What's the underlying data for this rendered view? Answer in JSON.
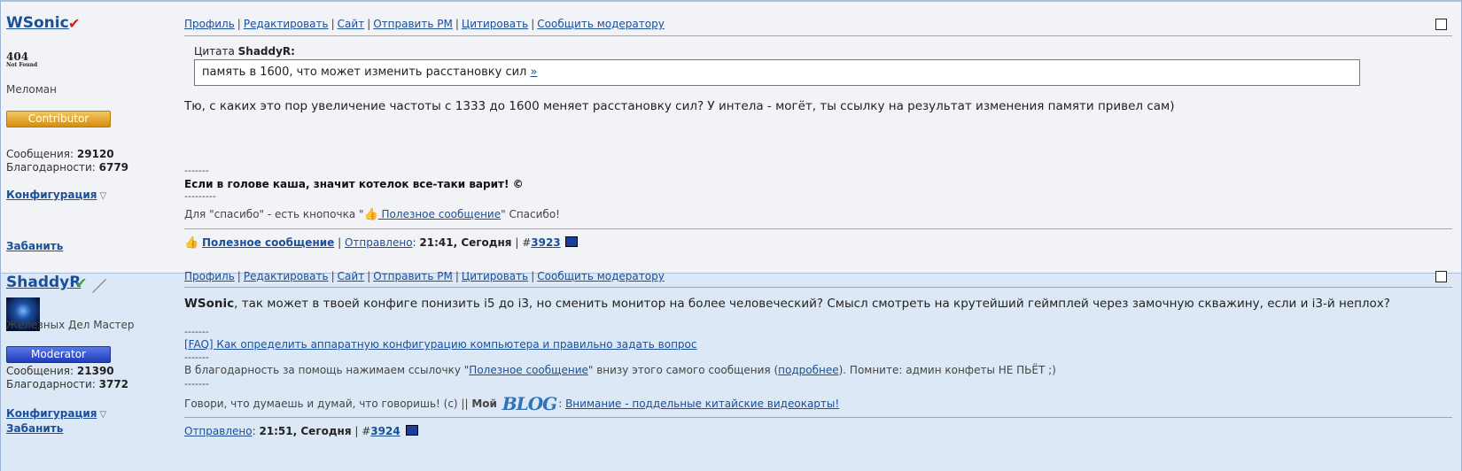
{
  "posts": [
    {
      "username": "WSonic",
      "title_icon": "check-red-icon",
      "avatar_text_big": "404",
      "avatar_text_small": "Not Found",
      "user_title": "Меломан",
      "badge": "Contributor",
      "messages_label": "Сообщения:",
      "messages_count": "29120",
      "thanks_label": "Благодарности:",
      "thanks_count": "6779",
      "config_link": "Конфигурация",
      "ban_link": "Забанить",
      "actions": [
        "Профиль",
        "Редактировать",
        "Сайт",
        "Отправить PM",
        "Цитировать",
        "Сообщить модератору"
      ],
      "quote": {
        "label": "Цитата",
        "author": "ShaddyR:",
        "text": "память в 1600, что может изменить расстановку сил",
        "link": "»"
      },
      "body": "Тю, с каких это пор увеличение частоты с 1333 до 1600 меняет расстановку сил? У интела - могёт, ты ссылку на результат изменения памяти привел сам)",
      "signature": {
        "sep1": "-------",
        "bold_line": "Если в голове каша, значит котелок все-таки варит! ©",
        "sep2": "---------",
        "line_pre": "Для \"спасибо\" - есть кнопочка \"",
        "line_link": " Полезное сообщение",
        "line_post": "\" Спасибо!"
      },
      "footer": {
        "useful": "Полезное сообщение",
        "sent_label": "Отправлено",
        "sent_time": "21:41, Сегодня",
        "hash": "#",
        "post_num": "3923"
      }
    },
    {
      "username": "ShaddyR",
      "title_icon": "check-green-icon",
      "user_title": "Железных Дел Мастер",
      "badge": "Moderator",
      "messages_label": "Сообщения:",
      "messages_count": "21390",
      "thanks_label": "Благодарности:",
      "thanks_count": "3772",
      "config_link": "Конфигурация",
      "ban_link": "Забанить",
      "actions": [
        "Профиль",
        "Редактировать",
        "Сайт",
        "Отправить PM",
        "Цитировать",
        "Сообщить модератору"
      ],
      "body_bold": "WSonic",
      "body": ", так может в твоей конфиге понизить i5 до i3, но сменить монитор на более человеческий? Смысл смотреть на крутейший геймплей через замочную скважину, если и i3-й неплох?",
      "signature": {
        "sep1": "-------",
        "faq_link": "[FAQ] Как определить аппаратную конфигурацию компьютера и правильно задать вопрос",
        "sep2": "-------",
        "thanks_pre": "В благодарность за помощь нажимаем ссылочку \"",
        "thanks_link": "Полезное сообщение",
        "thanks_mid": "\" внизу этого самого сообщения (",
        "thanks_link2": "подробнее",
        "thanks_post": "). Помните: админ конфеты НЕ ПЬЁТ ;)",
        "sep3": "-------",
        "motto": "Говори, что думаешь и думай, что говоришь! (с) || ",
        "my": "Мой",
        "blog": "BLOG",
        "blog_sep": ": ",
        "blog_link": "Внимание - поддельные китайские видеокарты!"
      },
      "footer": {
        "sent_label": "Отправлено",
        "sent_time": "21:51, Сегодня",
        "hash": "#",
        "post_num": "3924"
      }
    }
  ],
  "colors": {
    "link": "#1a4f9a",
    "post1_bg": "#f1f3f7",
    "post2_bg": "#dde8f6",
    "contributor_badge": "#e0a020",
    "moderator_badge": "#2a48c8"
  }
}
